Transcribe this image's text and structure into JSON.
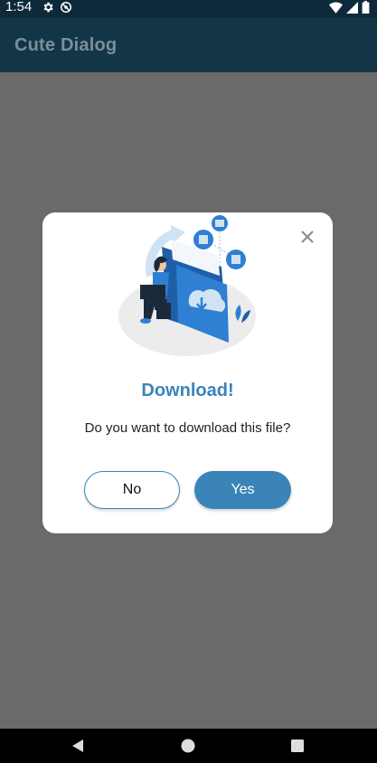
{
  "status_bar": {
    "time": "1:54",
    "left_icons": [
      "gear-icon",
      "sync-blocked-icon"
    ],
    "right_icons": [
      "wifi-icon",
      "cell-signal-icon",
      "battery-icon"
    ]
  },
  "app_bar": {
    "title": "Cute Dialog"
  },
  "dialog": {
    "title": "Download!",
    "message": "Do you want to download this file?",
    "no_label": "No",
    "yes_label": "Yes",
    "close_icon": "close-icon",
    "illustration": "download-file-illustration",
    "accent_color": "#3a84b8"
  },
  "nav_bar": {
    "icons": [
      "back-icon",
      "home-icon",
      "recents-icon"
    ]
  }
}
